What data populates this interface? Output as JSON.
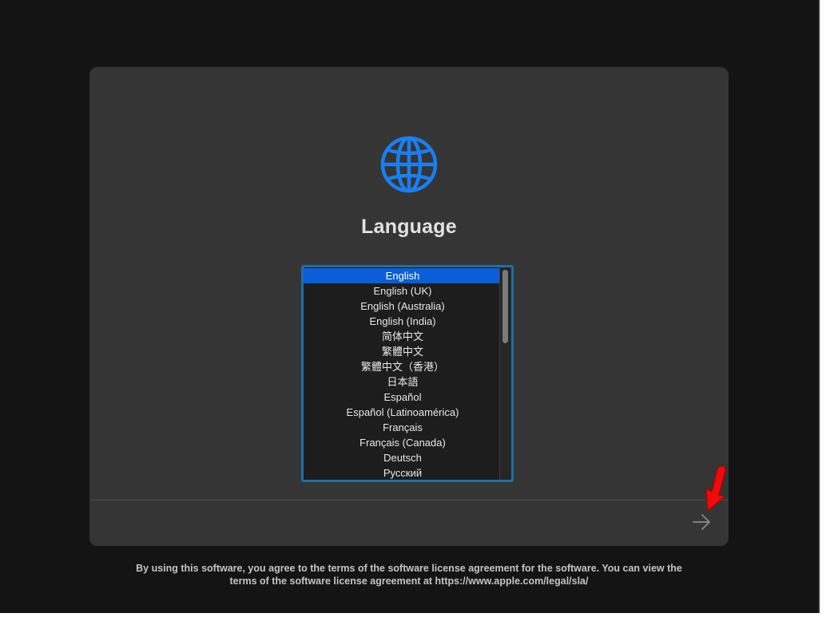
{
  "panel": {
    "icon": "globe-icon",
    "accent_color": "#1a7ff0",
    "title": "Language"
  },
  "languages": {
    "selected_index": 0,
    "items": [
      "English",
      "English (UK)",
      "English (Australia)",
      "English (India)",
      "简体中文",
      "繁體中文",
      "繁體中文（香港）",
      "日本語",
      "Español",
      "Español (Latinoamérica)",
      "Français",
      "Français (Canada)",
      "Deutsch",
      "Русский"
    ]
  },
  "footer": {
    "next_icon": "arrow-right-icon",
    "annotation_icon": "red-arrow-pointer-icon",
    "annotation_color": "#f00a0a"
  },
  "legal": {
    "line1": "By using this software, you agree to the terms of the software license agreement for the software. You can view the",
    "line2": "terms of the software license agreement at https://www.apple.com/legal/sla/"
  }
}
